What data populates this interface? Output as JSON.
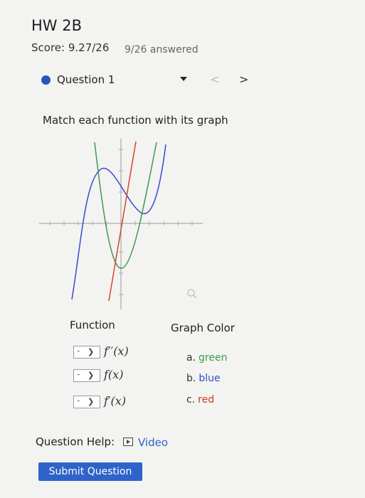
{
  "assignment": {
    "title": "HW 2B",
    "score": "Score: 9.27/26",
    "answered": "9/26 answered"
  },
  "question_nav": {
    "label": "Question 1",
    "prev_icon": "<",
    "next_icon": ">"
  },
  "prompt": "Match each function with its graph",
  "graph": {
    "curves": [
      {
        "color": "#3b4ad0",
        "color_name": "blue"
      },
      {
        "color": "#3f9a4c",
        "color_name": "green"
      },
      {
        "color": "#d2462c",
        "color_name": "red"
      }
    ]
  },
  "table": {
    "function_header": "Function",
    "color_header": "Graph Color",
    "functions": [
      {
        "select_value": "-",
        "label": "f′′(x)"
      },
      {
        "select_value": "-",
        "label": "f(x)"
      },
      {
        "select_value": "-",
        "label": "f′(x)"
      }
    ],
    "options": [
      {
        "letter": "a.",
        "name": "green",
        "color": "#3f9a4c"
      },
      {
        "letter": "b.",
        "name": "blue",
        "color": "#2f4fcf"
      },
      {
        "letter": "c.",
        "name": "red",
        "color": "#cc3a22"
      }
    ]
  },
  "help": {
    "label": "Question Help:",
    "video_link": "Video"
  },
  "submit_label": "Submit Question"
}
